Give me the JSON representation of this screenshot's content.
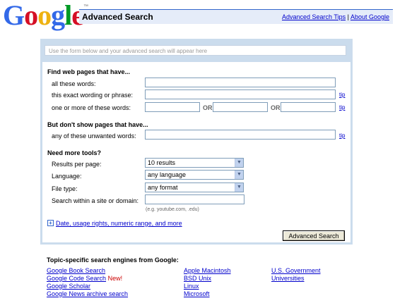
{
  "header": {
    "logo_letters": [
      {
        "ch": "G",
        "color": "#3369e8"
      },
      {
        "ch": "o",
        "color": "#d50f25"
      },
      {
        "ch": "o",
        "color": "#eeb211"
      },
      {
        "ch": "g",
        "color": "#3369e8"
      },
      {
        "ch": "l",
        "color": "#009925"
      },
      {
        "ch": "e",
        "color": "#d50f25"
      }
    ],
    "logo_tm": "™",
    "title": "Advanced Search",
    "link_tips": "Advanced Search Tips",
    "separator": "|",
    "link_about": "About Google"
  },
  "form": {
    "preview_placeholder": "Use the form below and your advanced search will appear here",
    "find_heading": "Find web pages that have...",
    "all_words_label": "all these words:",
    "exact_phrase_label": "this exact wording or phrase:",
    "one_or_more_label": "one or more of these words:",
    "or_label": "OR",
    "tip": "tip",
    "dont_show_heading": "But don't show pages that have...",
    "unwanted_label": "any of these unwanted words:",
    "more_tools_heading": "Need more tools?",
    "results_label": "Results per page:",
    "results_value": "10 results",
    "language_label": "Language:",
    "language_value": "any language",
    "filetype_label": "File type:",
    "filetype_value": "any format",
    "site_label": "Search within a site or domain:",
    "site_hint": "(e.g. youtube.com, .edu)",
    "date_link": "Date, usage rights, numeric range, and more",
    "submit_label": "Advanced Search"
  },
  "footer": {
    "heading": "Topic-specific search engines from Google:",
    "col1": [
      "Google Book Search",
      "Google Code Search",
      "Google Scholar",
      "Google News archive search"
    ],
    "new_badge": "New!",
    "col2": [
      "Apple Macintosh",
      "BSD Unix",
      "Linux",
      "Microsoft"
    ],
    "col3": [
      "U.S. Government",
      "Universities"
    ]
  },
  "colors": {
    "accent_blue": "#3366cc",
    "panel_bg": "#cbdced",
    "title_bg": "#e5ecf9",
    "link": "#0000cc",
    "new_red": "#cc0000"
  },
  "icons": {
    "dropdown": "chevron-down-icon",
    "expand": "plus-icon"
  }
}
